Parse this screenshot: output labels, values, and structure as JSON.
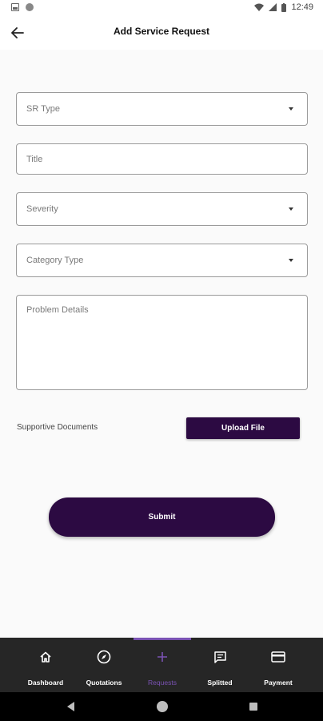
{
  "status_bar": {
    "time": "12:49"
  },
  "app_bar": {
    "title": "Add Service Request"
  },
  "form": {
    "sr_type_placeholder": "SR Type",
    "title_placeholder": "Title",
    "severity_placeholder": "Severity",
    "category_type_placeholder": "Category Type",
    "problem_details_placeholder": "Problem Details",
    "supportive_documents_label": "Supportive Documents",
    "upload_file_label": "Upload File",
    "submit_label": "Submit"
  },
  "bottom_nav": {
    "items": [
      {
        "label": "Dashboard",
        "icon": "home-icon"
      },
      {
        "label": "Quotations",
        "icon": "compass-icon"
      },
      {
        "label": "Requests",
        "icon": "plus-icon",
        "active": true
      },
      {
        "label": "Splitted",
        "icon": "chat-icon"
      },
      {
        "label": "Payment",
        "icon": "card-icon"
      }
    ]
  },
  "colors": {
    "primary": "#2c0a42",
    "active_nav": "#7a52b3",
    "nav_background": "#262626",
    "page_background": "#fafafa"
  }
}
